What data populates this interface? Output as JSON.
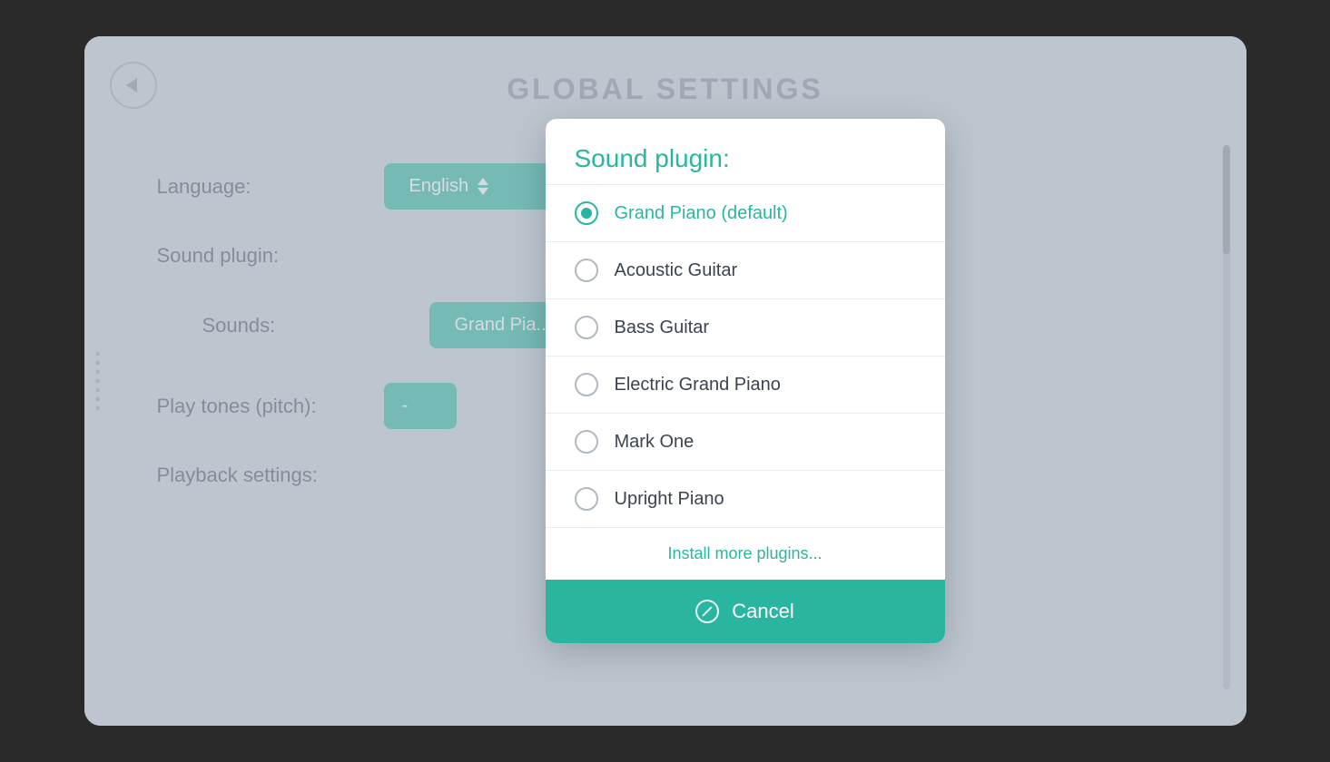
{
  "page": {
    "title": "GLOBAL SETTINGS"
  },
  "back_button_label": "←",
  "side_grip_count": 7,
  "settings": {
    "language_label": "Language:",
    "language_value": "English",
    "sound_plugin_label": "Sound plugin:",
    "sounds_label": "Sounds:",
    "sounds_value": "Grand Pia...",
    "play_tones_label": "Play tones (pitch):",
    "play_tones_value": "-",
    "playback_settings_label": "Playback settings:"
  },
  "modal": {
    "title": "Sound plugin:",
    "options": [
      {
        "id": "grand-piano",
        "label": "Grand Piano (default)",
        "selected": true
      },
      {
        "id": "acoustic-guitar",
        "label": "Acoustic Guitar",
        "selected": false
      },
      {
        "id": "bass-guitar",
        "label": "Bass Guitar",
        "selected": false
      },
      {
        "id": "electric-grand-piano",
        "label": "Electric Grand Piano",
        "selected": false
      },
      {
        "id": "mark-one",
        "label": "Mark One",
        "selected": false
      },
      {
        "id": "upright-piano",
        "label": "Upright Piano",
        "selected": false
      }
    ],
    "install_link": "Install more plugins...",
    "cancel_label": "Cancel"
  },
  "colors": {
    "teal": "#2ab5a0",
    "bg": "#c8d0d8",
    "text_dark": "#3a4450"
  }
}
